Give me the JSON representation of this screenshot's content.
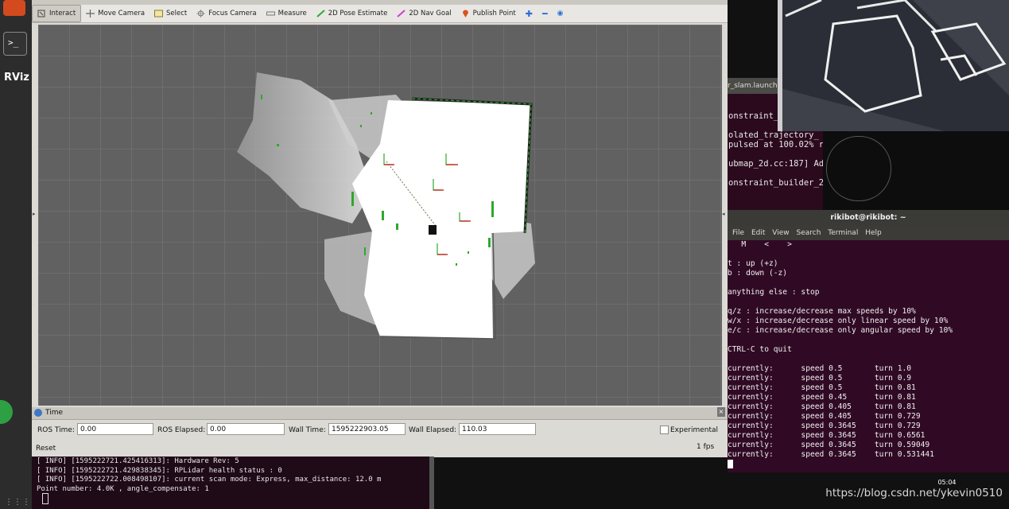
{
  "launcher": {
    "rviz_label": "RViz"
  },
  "rviz": {
    "title_fragment": "r_slam.launch",
    "tools": [
      {
        "label": "Interact",
        "icon": "interact-icon"
      },
      {
        "label": "Move Camera",
        "icon": "move-camera-icon"
      },
      {
        "label": "Select",
        "icon": "select-icon"
      },
      {
        "label": "Focus Camera",
        "icon": "focus-camera-icon"
      },
      {
        "label": "Measure",
        "icon": "measure-icon"
      },
      {
        "label": "2D Pose Estimate",
        "icon": "pose-estimate-icon"
      },
      {
        "label": "2D Nav Goal",
        "icon": "nav-goal-icon"
      },
      {
        "label": "Publish Point",
        "icon": "publish-point-icon"
      }
    ],
    "time_panel": {
      "title": "Time",
      "ros_time_label": "ROS Time:",
      "ros_time": "0.00",
      "ros_elapsed_label": "ROS Elapsed:",
      "ros_elapsed": "0.00",
      "wall_time_label": "Wall Time:",
      "wall_time": "1595222903.05",
      "wall_elapsed_label": "Wall Elapsed:",
      "wall_elapsed": "110.03",
      "experimental_label": "Experimental",
      "reset_label": "Reset",
      "fps": "1 fps"
    }
  },
  "log_terminal": {
    "lines": [
      "[ INFO] [1595222721.425416313]: Hardware Rev: 5",
      "[ INFO] [1595222721.429838345]: RPLidar health status : 0",
      "[ INFO] [1595222722.008498107]: current scan mode: Express, max_distance: 12.0 m",
      "Point number: 4.0K , angle_compensate: 1"
    ]
  },
  "mid_terminal": {
    "lines": [
      "onstraint_b",
      "",
      "olated_trajectory_",
      "pulsed at 100.02% r",
      "",
      "ubmap_2d.cc:187] Ad",
      "",
      "onstraint_builder_2"
    ]
  },
  "main_terminal": {
    "title": "rikibot@rikibot: ~",
    "menu": [
      "File",
      "Edit",
      "View",
      "Search",
      "Terminal",
      "Help"
    ],
    "lines": [
      "   M    <    >",
      "",
      "t : up (+z)",
      "b : down (-z)",
      "",
      "anything else : stop",
      "",
      "q/z : increase/decrease max speeds by 10%",
      "w/x : increase/decrease only linear speed by 10%",
      "e/c : increase/decrease only angular speed by 10%",
      "",
      "CTRL-C to quit",
      "",
      "currently:      speed 0.5       turn 1.0",
      "currently:      speed 0.5       turn 0.9",
      "currently:      speed 0.5       turn 0.81",
      "currently:      speed 0.45      turn 0.81",
      "currently:      speed 0.405     turn 0.81",
      "currently:      speed 0.405     turn 0.729",
      "currently:      speed 0.3645    turn 0.729",
      "currently:      speed 0.3645    turn 0.6561",
      "currently:      speed 0.3645    turn 0.59049",
      "currently:      speed 0.3645    turn 0.531441"
    ]
  },
  "clock": "05:04",
  "watermark": "https://blog.csdn.net/ykevin0510"
}
